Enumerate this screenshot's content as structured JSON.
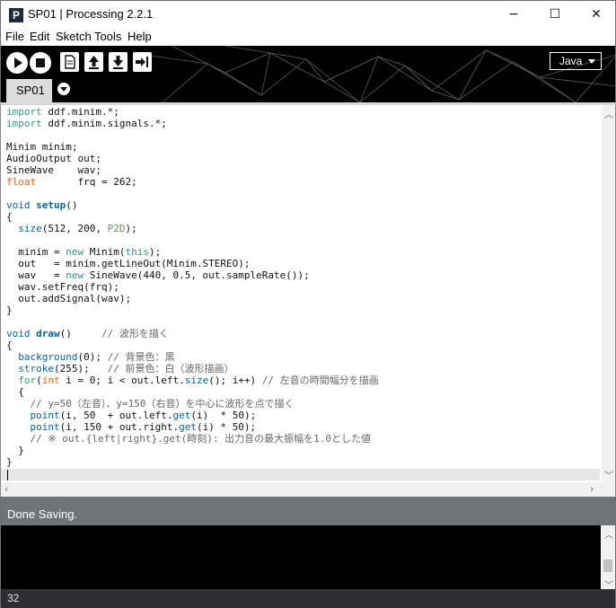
{
  "window": {
    "title": "SP01 | Processing 2.2.1",
    "app_icon_letter": "P",
    "minimize_glyph": "−",
    "maximize_glyph": "☐",
    "close_glyph": "✕"
  },
  "menu": [
    "File",
    "Edit",
    "Sketch",
    "Tools",
    "Help"
  ],
  "toolbar": {
    "buttons": [
      "run-icon",
      "stop-icon",
      "new-icon",
      "open-icon",
      "save-icon",
      "export-icon"
    ],
    "mode": "Java"
  },
  "tabs": [
    {
      "label": "SP01"
    }
  ],
  "code": [
    [
      {
        "t": "import",
        "c": "imp"
      },
      {
        "t": " ddf.minim.*;"
      }
    ],
    [
      {
        "t": "import",
        "c": "imp"
      },
      {
        "t": " ddf.minim.signals.*;"
      }
    ],
    [],
    [
      {
        "t": "Minim minim;"
      }
    ],
    [
      {
        "t": "AudioOutput out;"
      }
    ],
    [
      {
        "t": "SineWave    wav;"
      }
    ],
    [
      {
        "t": "float",
        "c": "type"
      },
      {
        "t": "       frq = 262;"
      }
    ],
    [],
    [
      {
        "t": "void",
        "c": "blue"
      },
      {
        "t": " "
      },
      {
        "t": "setup",
        "c": "fn"
      },
      {
        "t": "()"
      }
    ],
    [
      {
        "t": "{"
      }
    ],
    [
      {
        "t": "  "
      },
      {
        "t": "size",
        "c": "call"
      },
      {
        "t": "(512, 200, "
      },
      {
        "t": "P2D",
        "c": "const"
      },
      {
        "t": ");"
      }
    ],
    [],
    [
      {
        "t": "  minim = "
      },
      {
        "t": "new",
        "c": "new"
      },
      {
        "t": " Minim("
      },
      {
        "t": "this",
        "c": "new"
      },
      {
        "t": ");"
      }
    ],
    [
      {
        "t": "  out   = minim.getLineOut(Minim.STEREO);"
      }
    ],
    [
      {
        "t": "  wav   = "
      },
      {
        "t": "new",
        "c": "new"
      },
      {
        "t": " SineWave(440, 0.5, out.sampleRate());"
      }
    ],
    [
      {
        "t": "  wav.setFreq(frq);"
      }
    ],
    [
      {
        "t": "  out.addSignal(wav);"
      }
    ],
    [
      {
        "t": "}"
      }
    ],
    [],
    [
      {
        "t": "void",
        "c": "blue"
      },
      {
        "t": " "
      },
      {
        "t": "draw",
        "c": "fn"
      },
      {
        "t": "()     "
      },
      {
        "t": "// 波形を描く",
        "c": "cmt"
      }
    ],
    [
      {
        "t": "{"
      }
    ],
    [
      {
        "t": "  "
      },
      {
        "t": "background",
        "c": "call"
      },
      {
        "t": "(0); "
      },
      {
        "t": "// 背景色：黒",
        "c": "cmt"
      }
    ],
    [
      {
        "t": "  "
      },
      {
        "t": "stroke",
        "c": "call"
      },
      {
        "t": "(255);   "
      },
      {
        "t": "// 前景色：白（波形描画）",
        "c": "cmt"
      }
    ],
    [
      {
        "t": "  "
      },
      {
        "t": "for",
        "c": "new"
      },
      {
        "t": "("
      },
      {
        "t": "int",
        "c": "type"
      },
      {
        "t": " i = 0; i < out.left."
      },
      {
        "t": "size",
        "c": "call"
      },
      {
        "t": "(); i++) "
      },
      {
        "t": "// 左音の時間幅分を描画",
        "c": "cmt"
      }
    ],
    [
      {
        "t": "  {"
      }
    ],
    [
      {
        "t": "    "
      },
      {
        "t": "// y=50（左音）、y=150（右音）を中心に波形を点で描く",
        "c": "cmt"
      }
    ],
    [
      {
        "t": "    "
      },
      {
        "t": "point",
        "c": "call"
      },
      {
        "t": "(i, 50  + out.left."
      },
      {
        "t": "get",
        "c": "call"
      },
      {
        "t": "(i)  * 50);"
      }
    ],
    [
      {
        "t": "    "
      },
      {
        "t": "point",
        "c": "call"
      },
      {
        "t": "(i, 150 + out.right."
      },
      {
        "t": "get",
        "c": "call"
      },
      {
        "t": "(i) * 50);"
      }
    ],
    [
      {
        "t": "    "
      },
      {
        "t": "// ※ out.{left|right}.get(時刻): 出力音の最大振幅を1.0とした値",
        "c": "cmt"
      }
    ],
    [
      {
        "t": "  }"
      }
    ],
    [
      {
        "t": "}"
      }
    ],
    []
  ],
  "status": {
    "message": "Done Saving."
  },
  "footer": {
    "line_number": "32"
  },
  "colors": {
    "header_bg": "#000000",
    "status_bg": "#6f7479",
    "console_bg": "#000000",
    "footer_bg": "#2b2f33",
    "keyword_green": "#33997e",
    "type_orange": "#e2661a",
    "function_blue": "#006699"
  }
}
